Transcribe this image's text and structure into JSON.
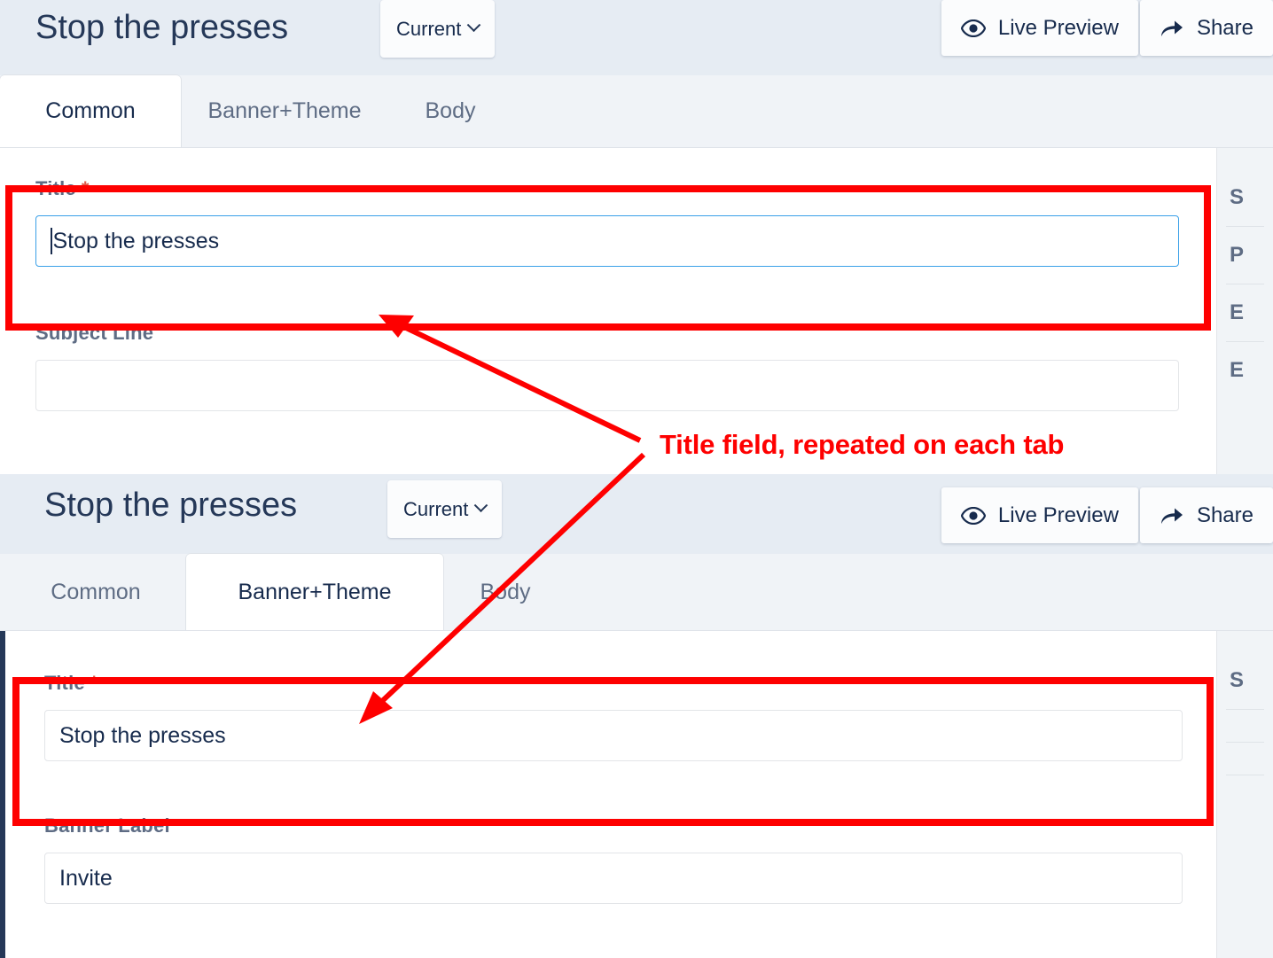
{
  "annotation": {
    "text": "Title field, repeated on each tab",
    "color": "#fe0000"
  },
  "panels": [
    {
      "id": "panel-common",
      "header": {
        "title": "Stop the presses",
        "version_selector": {
          "label": "Current",
          "icon": "chevron-down-icon"
        },
        "actions": [
          {
            "label": "Live Preview",
            "icon": "eye-icon"
          },
          {
            "label": "Share",
            "icon": "share-arrow-icon"
          }
        ]
      },
      "tabs": [
        {
          "label": "Common",
          "active": true
        },
        {
          "label": "Banner+Theme",
          "active": false
        },
        {
          "label": "Body",
          "active": false
        }
      ],
      "fields": [
        {
          "label": "Title",
          "required": true,
          "value": "Stop the presses",
          "focused": true,
          "highlighted": true
        },
        {
          "label": "Subject Line",
          "required": false,
          "value": "",
          "focused": false,
          "highlighted": false
        }
      ],
      "sidebar_items": [
        "S",
        "P",
        "E",
        "E"
      ]
    },
    {
      "id": "panel-banner-theme",
      "header": {
        "title": "Stop the presses",
        "version_selector": {
          "label": "Current",
          "icon": "chevron-down-icon"
        },
        "actions": [
          {
            "label": "Live Preview",
            "icon": "eye-icon"
          },
          {
            "label": "Share",
            "icon": "share-arrow-icon"
          }
        ]
      },
      "tabs": [
        {
          "label": "Common",
          "active": false
        },
        {
          "label": "Banner+Theme",
          "active": true
        },
        {
          "label": "Body",
          "active": false
        }
      ],
      "fields": [
        {
          "label": "Title",
          "required": true,
          "value": "Stop the presses",
          "focused": false,
          "highlighted": true
        },
        {
          "label": "Banner Label",
          "required": false,
          "value": "Invite",
          "focused": false,
          "highlighted": false
        }
      ],
      "sidebar_items": [
        "S",
        "",
        "",
        ""
      ]
    }
  ],
  "colors": {
    "header_bg": "#e6ecf3",
    "tabstrip_bg": "#f0f3f7",
    "sidebar_bg": "#f1f4f7",
    "title_text": "#253858",
    "label_text": "#5e6c84",
    "focus_border": "#3aa0e8",
    "required_star": "#de5b4b",
    "annotation": "#fe0000",
    "dark_edge": "#253858"
  }
}
